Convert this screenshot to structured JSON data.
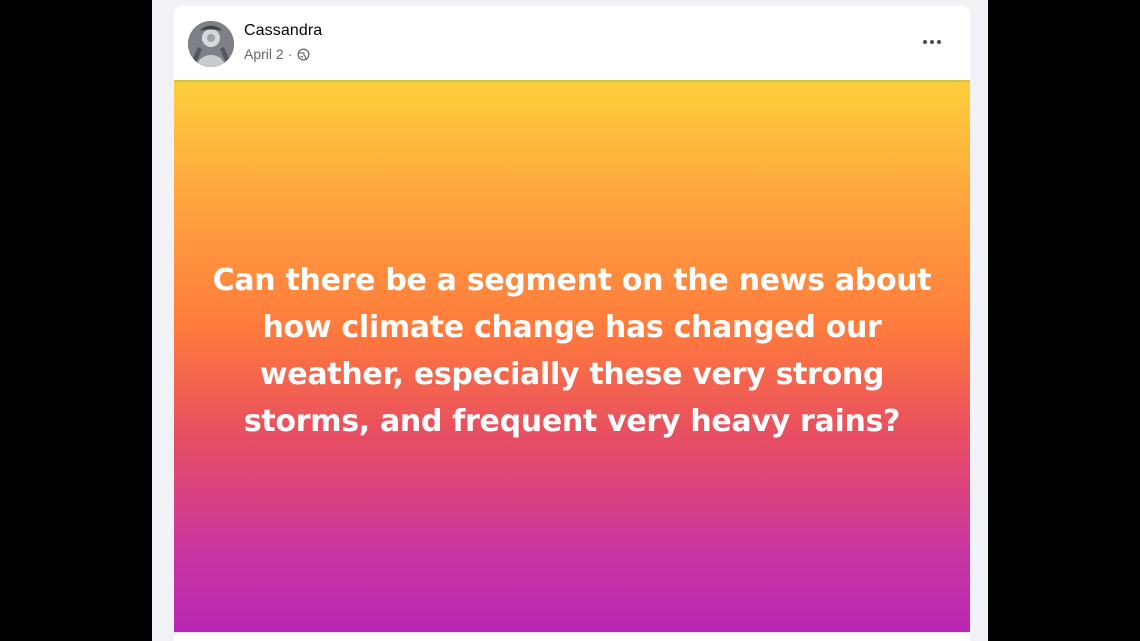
{
  "post": {
    "author": "Cassandra",
    "date": "April 2",
    "separator": "·",
    "audience_icon": "globe-icon",
    "more_icon": "more-options-icon",
    "text": "Can there be a segment on the news about how climate change has changed our weather, especially these very strong storms, and frequent very heavy rains?",
    "background_colors": [
      "#fdcf3c",
      "#ff7a3d",
      "#b827b4"
    ]
  }
}
